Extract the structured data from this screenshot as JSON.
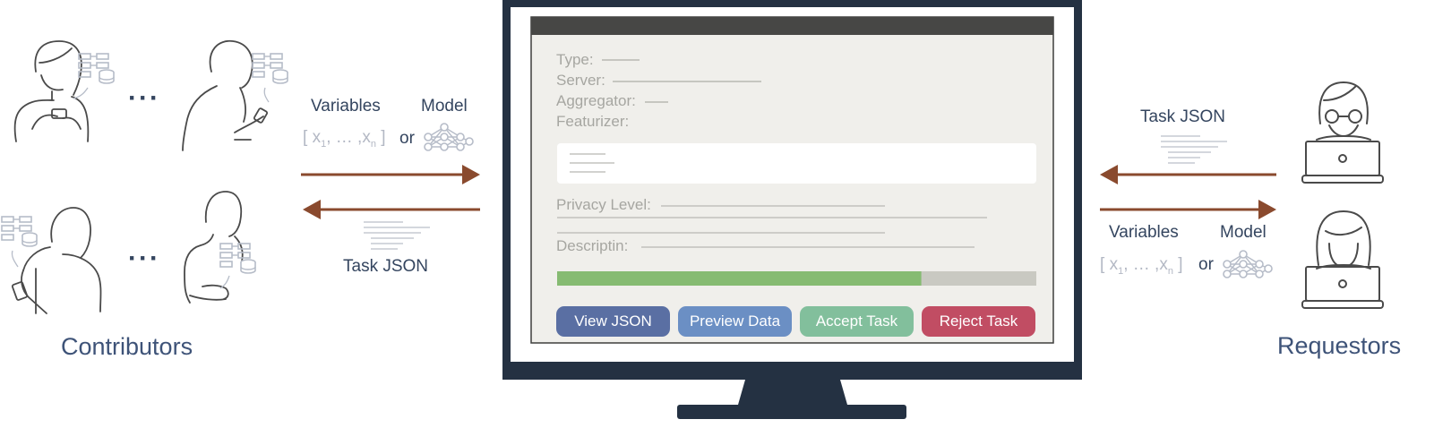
{
  "contributors": {
    "title": "Contributors",
    "ellipsis_top": "···",
    "ellipsis_bottom": "···"
  },
  "requestors": {
    "title": "Requestors"
  },
  "left_flow": {
    "variables_label": "Variables",
    "model_label": "Model",
    "vector_open": "[",
    "vector_x1": "x",
    "vector_sub1": "1",
    "vector_mid": ", … ,",
    "vector_xn": "x",
    "vector_subn": "n",
    "vector_close": "]",
    "or_label": "or",
    "task_json_label": "Task JSON"
  },
  "right_flow": {
    "task_json_label": "Task JSON",
    "variables_label": "Variables",
    "model_label": "Model",
    "vector_open": "[",
    "vector_x1": "x",
    "vector_sub1": "1",
    "vector_mid": ", … ,",
    "vector_xn": "x",
    "vector_subn": "n",
    "vector_close": "]",
    "or_label": "or"
  },
  "task_form": {
    "type_label": "Type:",
    "server_label": "Server:",
    "aggregator_label": "Aggregator:",
    "featurizer_label": "Featurizer:",
    "privacy_label": "Privacy Level:",
    "description_label": "Descriptin:",
    "progress_fraction": 0.76,
    "buttons": {
      "view_json": "View JSON",
      "preview_data": "Preview Data",
      "accept_task": "Accept Task",
      "reject_task": "Reject Task"
    }
  },
  "colors": {
    "arrow": "#8a4a2e",
    "navy": "#34455f",
    "monitor": "#243142",
    "view_json": "#5a6fa3",
    "preview_data": "#6b8fc4",
    "accept_task": "#82bf9c",
    "reject_task": "#c14d63",
    "progress_fill": "#86bb72",
    "progress_track": "#c9c9c2"
  },
  "icons": {
    "model": "neural-network-icon",
    "dataset": "dataset-database-icon",
    "person_phone": "person-with-phone-icon",
    "person_laptop": "person-with-laptop-icon",
    "document": "document-lines-icon"
  }
}
